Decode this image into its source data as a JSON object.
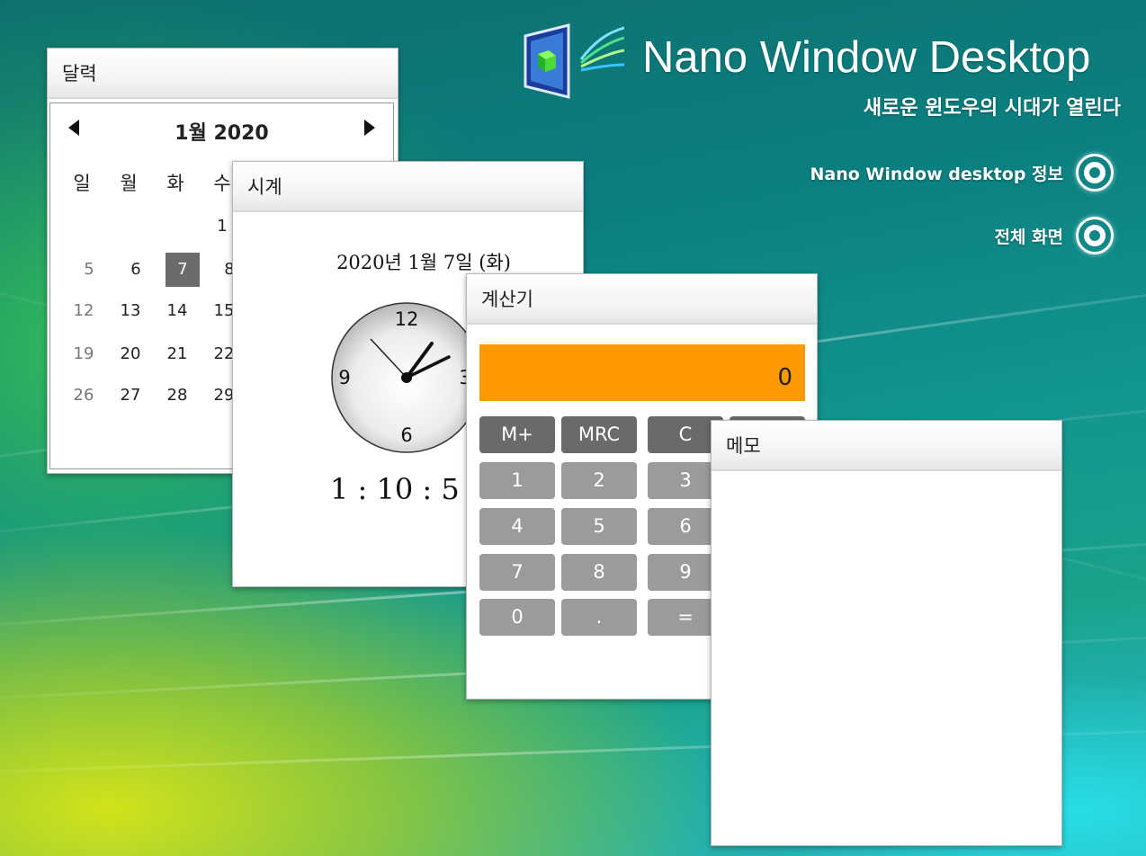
{
  "brand": {
    "title": "Nano Window Desktop",
    "subtitle": "새로운 윈도우의 시대가 열린다"
  },
  "menu": [
    {
      "label": "Nano Window desktop 정보"
    },
    {
      "label": "전체 화면"
    }
  ],
  "calendar": {
    "title": "달력",
    "month_label": "1월 2020",
    "weekdays": [
      "일",
      "월",
      "화",
      "수"
    ],
    "rows": [
      [
        "",
        "",
        "",
        "1"
      ],
      [
        "5",
        "6",
        "7",
        "8"
      ],
      [
        "12",
        "13",
        "14",
        "15"
      ],
      [
        "19",
        "20",
        "21",
        "22"
      ],
      [
        "26",
        "27",
        "28",
        "29"
      ]
    ],
    "today": "7"
  },
  "clock": {
    "title": "시계",
    "date": "2020년 1월 7일 (화)",
    "time": "1 : 10 : 5",
    "numerals": {
      "n12": "12",
      "n3": "3",
      "n6": "6",
      "n9": "9"
    }
  },
  "calculator": {
    "title": "계산기",
    "display": "0",
    "buttons": {
      "mplus": "M+",
      "mrc": "MRC",
      "c": "C",
      "b1": "1",
      "b2": "2",
      "b3": "3",
      "b4": "4",
      "b5": "5",
      "b6": "6",
      "b7": "7",
      "b8": "8",
      "b9": "9",
      "b0": "0",
      "dot": ".",
      "eq": "="
    },
    "colors": {
      "display": "#ff9900",
      "dark_button": "#6a6a6a",
      "light_button": "#9b9b9b"
    }
  },
  "memo": {
    "title": "메모",
    "value": ""
  }
}
